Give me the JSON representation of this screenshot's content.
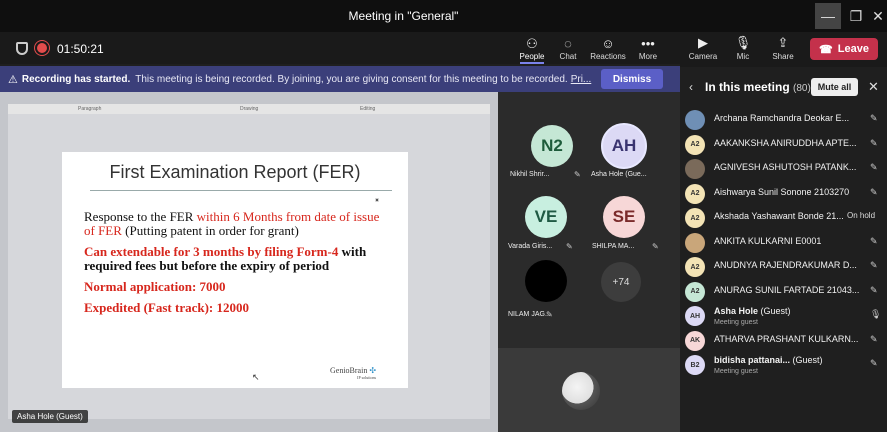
{
  "window": {
    "title": "Meeting in \"General\""
  },
  "toolbar": {
    "timer": "01:50:21",
    "buttons": [
      {
        "label": "People",
        "icon": "people-icon"
      },
      {
        "label": "Chat",
        "icon": "chat-icon"
      },
      {
        "label": "Reactions",
        "icon": "reactions-icon"
      },
      {
        "label": "More",
        "icon": "more-icon"
      }
    ],
    "right": [
      {
        "label": "Camera",
        "icon": "camera-off-icon"
      },
      {
        "label": "Mic",
        "icon": "mic-off-icon"
      },
      {
        "label": "Share",
        "icon": "share-icon"
      }
    ],
    "leave": "Leave"
  },
  "banner": {
    "bold": "Recording has started.",
    "message": "This meeting is being recorded. By joining, you are giving consent for this meeting to be recorded.",
    "link": "Pri...",
    "dismiss": "Dismiss"
  },
  "stage": {
    "ribbon": [
      "Paragraph",
      "Drawing",
      "Editing"
    ],
    "slide_title": "First Examination Report (FER)",
    "line1a": "Response to the FER ",
    "line1b": "within 6 Months from date of issue of FER",
    "line1c": " (Putting patent in order for grant)",
    "line2a": "Can extendable for 3 months by filing Form-4",
    "line2b": " with required fees but before the expiry of period",
    "line3": "Normal application: 7000",
    "line4": "Expedited (Fast track): 12000",
    "brand": "GenioBrain",
    "brand_sub": "IP solutions",
    "presenter": "Asha Hole (Guest)"
  },
  "gallery": {
    "tiles": [
      {
        "initials": "N2",
        "name": "Nikhil Shrir...",
        "bg": "#c5e7d5",
        "fg": "#1e5b3a"
      },
      {
        "initials": "AH",
        "name": "Asha Hole (Gue...",
        "bg": "#dcd9f5",
        "fg": "#3a3470"
      },
      {
        "initials": "VE",
        "name": "Varada Giris...",
        "bg": "#c8efe0",
        "fg": "#1f5a44"
      },
      {
        "initials": "SE",
        "name": "SHILPA MA...",
        "bg": "#f7d7d7",
        "fg": "#7a2a2a"
      },
      {
        "initials": "",
        "name": "NILAM JAG...",
        "bg": "#000000",
        "fg": "#000000"
      }
    ],
    "overflow": "+74"
  },
  "panel": {
    "title": "In this meeting",
    "count": "(80)",
    "mute_all": "Mute all",
    "participants": [
      {
        "initials": "",
        "name": "Archana Ramchandra Deokar E...",
        "bg": "#6f8fb5",
        "status": ""
      },
      {
        "initials": "A2",
        "name": "AAKANKSHA ANIRUDDHA APTE...",
        "bg": "#f3e3b5",
        "status": ""
      },
      {
        "initials": "",
        "name": "AGNIVESH ASHUTOSH PATANK...",
        "bg": "#7a6a5a",
        "status": ""
      },
      {
        "initials": "A2",
        "name": "Aishwarya Sunil Sonone 2103270",
        "bg": "#f3e3b5",
        "status": ""
      },
      {
        "initials": "A2",
        "name": "Akshada Yashawant Bonde 21...",
        "bg": "#f3e3b5",
        "status": "On hold"
      },
      {
        "initials": "",
        "name": "ANKITA KULKARNI E0001",
        "bg": "#c9a67a",
        "status": ""
      },
      {
        "initials": "A2",
        "name": "ANUDNYA RAJENDRAKUMAR D...",
        "bg": "#f3e3b5",
        "status": ""
      },
      {
        "initials": "A2",
        "name": "ANURAG SUNIL FARTADE 21043...",
        "bg": "#c5e7d5",
        "status": ""
      },
      {
        "initials": "AH",
        "name": "Asha Hole",
        "guest": "(Guest)",
        "sub": "Meeting guest",
        "bg": "#dcd9f5",
        "status": "mic"
      },
      {
        "initials": "AK",
        "name": "ATHARVA PRASHANT KULKARN...",
        "bg": "#f7d7d7",
        "status": ""
      },
      {
        "initials": "B2",
        "name": "bidisha pattanai...",
        "guest": "(Guest)",
        "sub": "Meeting guest",
        "bg": "#dcd9f5",
        "status": ""
      }
    ]
  }
}
